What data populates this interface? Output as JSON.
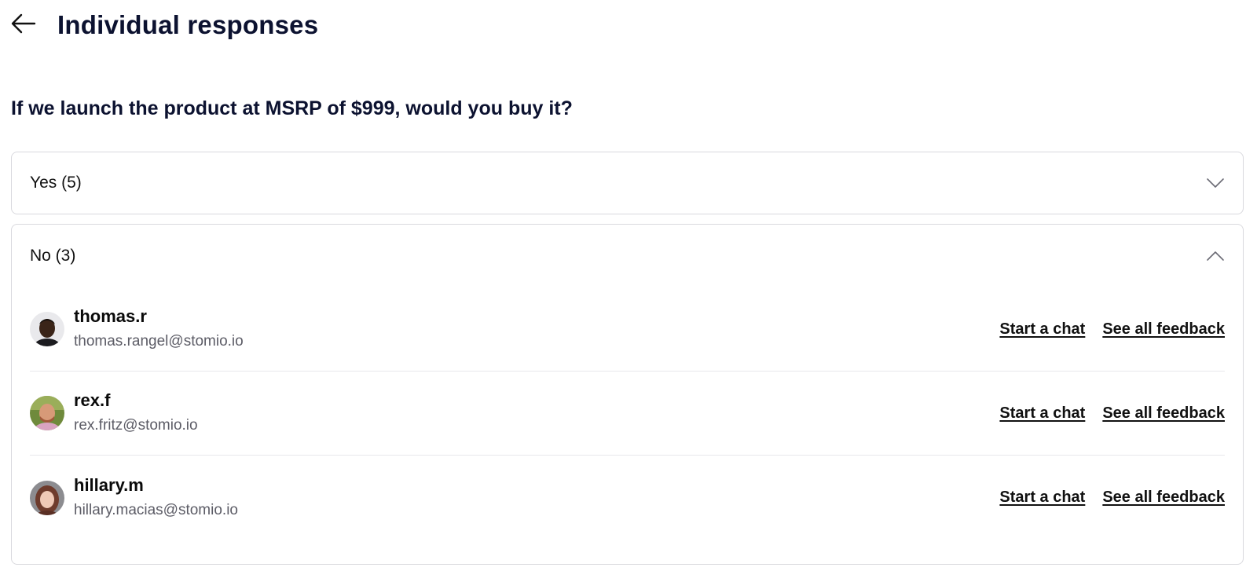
{
  "header": {
    "back_icon": "arrow-left-icon",
    "title": "Individual responses"
  },
  "question": "If we launch the product at MSRP of $999, would you buy it?",
  "groups": [
    {
      "label": "Yes (5)",
      "expanded": false,
      "chevron_icon": "chevron-down-icon"
    },
    {
      "label": "No (3)",
      "expanded": true,
      "chevron_icon": "chevron-up-icon",
      "responders": [
        {
          "username": "thomas.r",
          "email": "thomas.rangel@stomio.io",
          "chat_label": "Start a chat",
          "feedback_label": "See all feedback"
        },
        {
          "username": "rex.f",
          "email": "rex.fritz@stomio.io",
          "chat_label": "Start a chat",
          "feedback_label": "See all feedback"
        },
        {
          "username": "hillary.m",
          "email": "hillary.macias@stomio.io",
          "chat_label": "Start a chat",
          "feedback_label": "See all feedback"
        }
      ]
    }
  ]
}
